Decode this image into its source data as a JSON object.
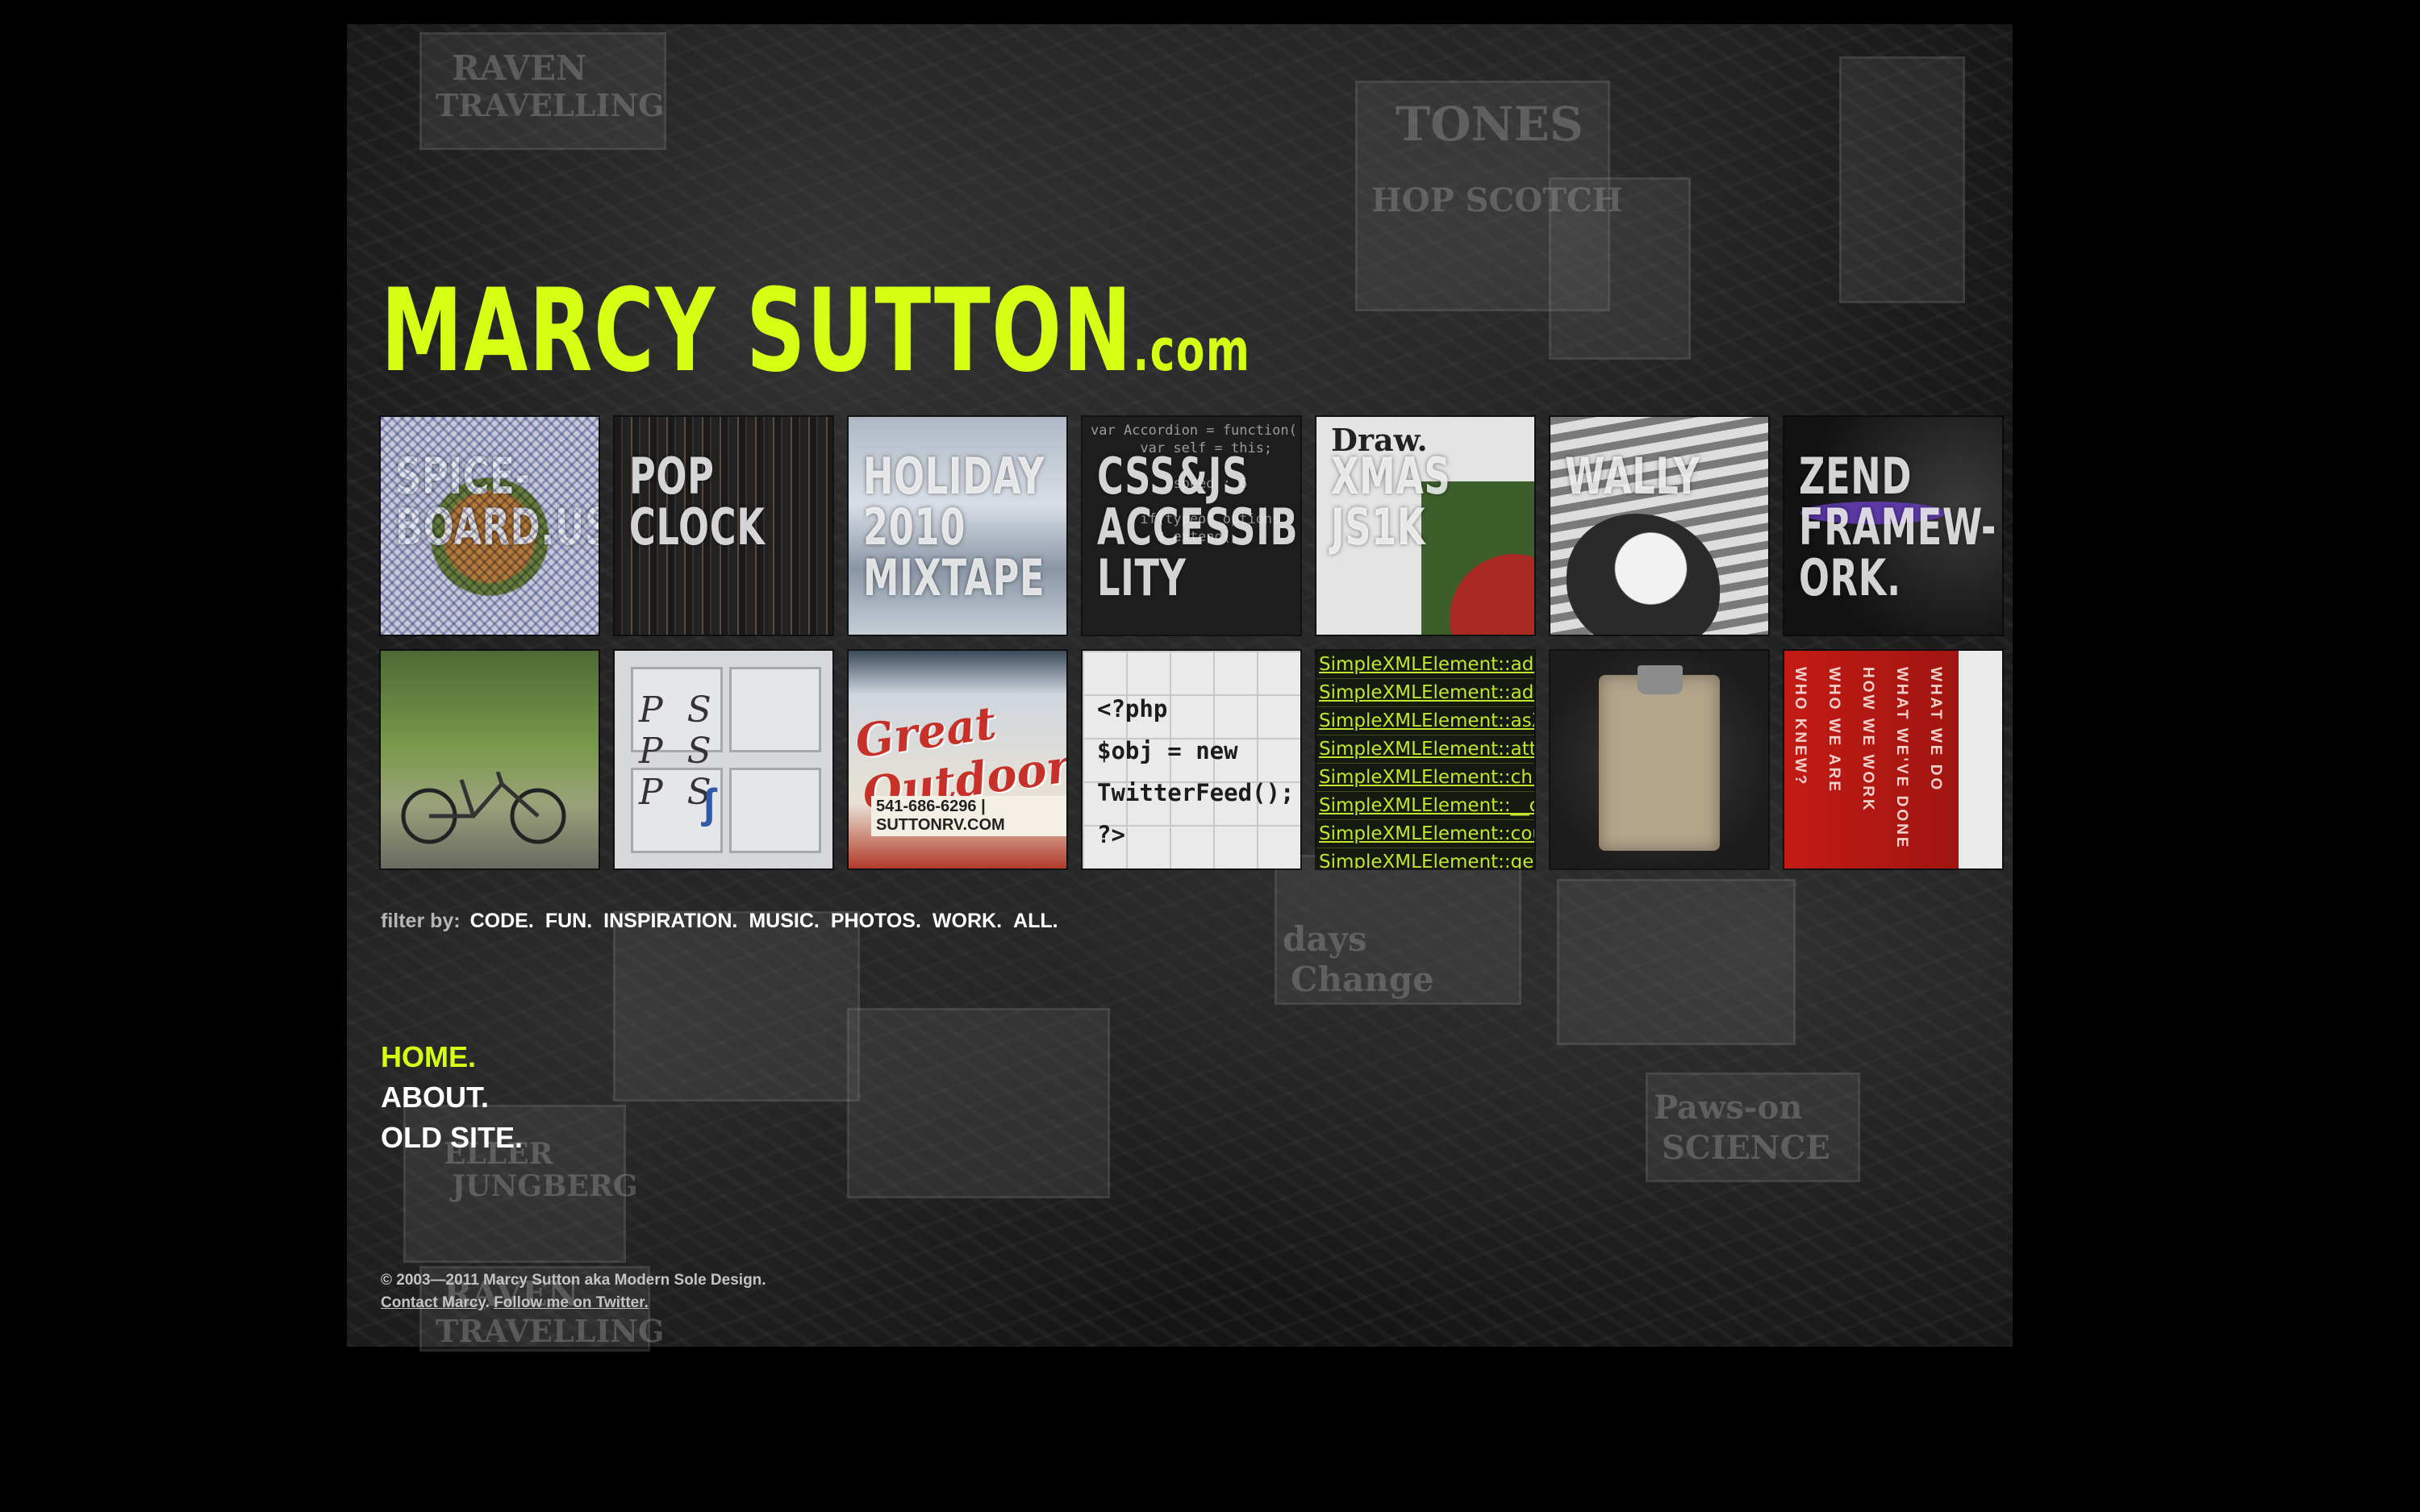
{
  "logo": {
    "main": "MARCY SUTTON",
    "domain": ".com"
  },
  "accent_color": "#d4ff14",
  "tiles": [
    {
      "label": "SPICE-BOARD.US"
    },
    {
      "label": "POP CLOCK"
    },
    {
      "label": "HOLIDAY 2010 MIXTAPE"
    },
    {
      "label": "CSS&JS ACCESSIBI-LITY",
      "code": "var Accordion = function(\n      var self = this;\n\n          speed : 6\n\n      if(typeof options\n        $.extend("
    },
    {
      "label": "XMAS JS1K",
      "overlay": "Draw."
    },
    {
      "label": "WALLY"
    },
    {
      "label": "ZEND FRAMEW-ORK."
    },
    {
      "label": ""
    },
    {
      "label": "",
      "letters": "PS PS PS"
    },
    {
      "label": "",
      "sign": "Great Outdoors",
      "phone": "541-686-6296 | SUTTONRV.COM"
    },
    {
      "label": "",
      "code": "<?php\n$obj = new\nTwitterFeed();\n?>"
    },
    {
      "label": "",
      "lines": [
        "SimpleXMLElement::addA",
        "SimpleXMLElement::addC",
        "SimpleXMLElement::asXM",
        "SimpleXMLElement::attrib",
        "SimpleXMLElement::child",
        "SimpleXMLElement::__co",
        "SimpleXMLElement::coun",
        "SimpleXMLElement::getD"
      ]
    },
    {
      "label": ""
    },
    {
      "label": "",
      "cols": [
        "WHO KNEW?",
        "WHO WE ARE",
        "HOW WE WORK",
        "WHAT WE'VE DONE",
        "WHAT WE DO"
      ]
    }
  ],
  "filter": {
    "label": "filter by:",
    "items": [
      "CODE.",
      "FUN.",
      "INSPIRATION.",
      "MUSIC.",
      "PHOTOS.",
      "WORK.",
      "ALL."
    ]
  },
  "nav": {
    "home": "HOME.",
    "about": "ABOUT.",
    "old_site": "OLD SITE."
  },
  "footer": {
    "copyright": "© 2003—2011 Marcy Sutton aka Modern Sole Design.",
    "contact": "Contact Marcy",
    "separator": ".",
    "twitter": "Follow me on Twitter."
  }
}
